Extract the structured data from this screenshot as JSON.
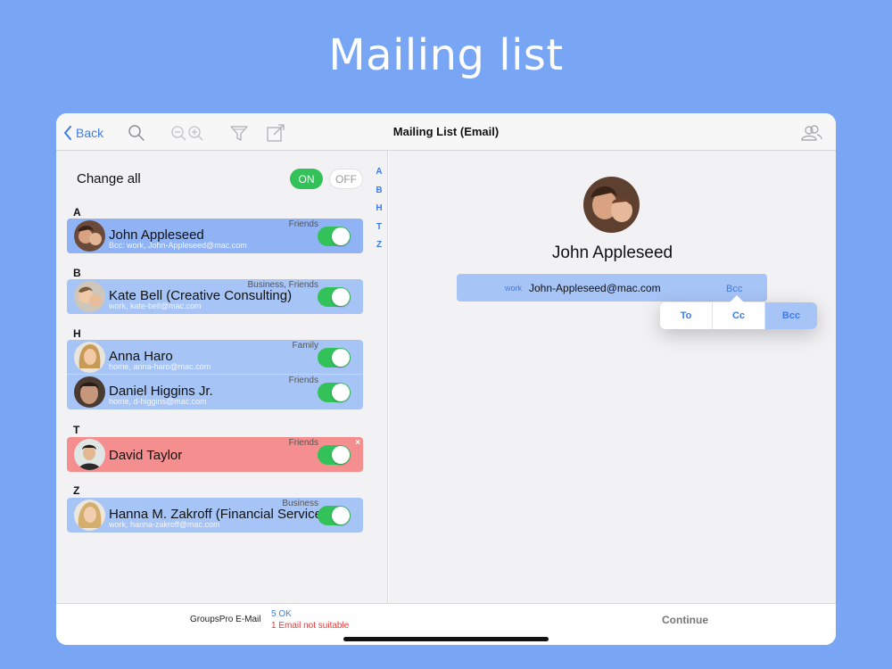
{
  "headline": "Mailing list",
  "nav": {
    "back_label": "Back",
    "title": "Mailing List (Email)",
    "icons": [
      "search-icon",
      "zoom-out-icon",
      "zoom-in-icon",
      "filter-icon",
      "share-icon",
      "groups-icon"
    ]
  },
  "left": {
    "change_all": "Change all",
    "on_label": "ON",
    "off_label": "OFF",
    "index": [
      "A",
      "B",
      "H",
      "T",
      "Z"
    ],
    "sections": [
      {
        "letter": "A",
        "contacts": [
          {
            "name": "John Appleseed",
            "group": "Friends",
            "email": "Bcc: work, John-Appleseed@mac.com",
            "state": "selected"
          }
        ]
      },
      {
        "letter": "B",
        "contacts": [
          {
            "name": "Kate Bell (Creative Consulting)",
            "group": "Business, Friends",
            "email": "work, kate-bell@mac.com",
            "state": "normal"
          }
        ]
      },
      {
        "letter": "H",
        "contacts": [
          {
            "name": "Anna Haro",
            "group": "Family",
            "email": "home, anna-haro@mac.com",
            "state": "normal"
          },
          {
            "name": "Daniel Higgins Jr.",
            "group": "Friends",
            "email": "home, d-higgins@mac.com",
            "state": "normal"
          }
        ]
      },
      {
        "letter": "T",
        "contacts": [
          {
            "name": "David Taylor",
            "group": "Friends",
            "email": "",
            "state": "error",
            "remove": "×"
          }
        ]
      },
      {
        "letter": "Z",
        "contacts": [
          {
            "name": "Hanna M. Zakroff (Financial Services)",
            "group": "Business",
            "email": "work, hanna-zakroff@mac.com",
            "state": "normal"
          }
        ]
      }
    ]
  },
  "detail": {
    "name": "John Appleseed",
    "email_label": "work",
    "email_value": "John-Appleseed@mac.com",
    "email_type": "Bcc",
    "options": [
      "To",
      "Cc",
      "Bcc"
    ],
    "selected_option": "Bcc"
  },
  "bottom": {
    "app_name": "GroupsPro E-Mail",
    "status_ok": "5 OK",
    "status_bad": "1 Email not suitable",
    "continue_label": "Continue"
  },
  "colors": {
    "background": "#78a6f4",
    "accent": "#3f7be6",
    "row": "#a7c4f6",
    "row_error": "#f58e8e",
    "toggle_on": "#33c15a"
  }
}
